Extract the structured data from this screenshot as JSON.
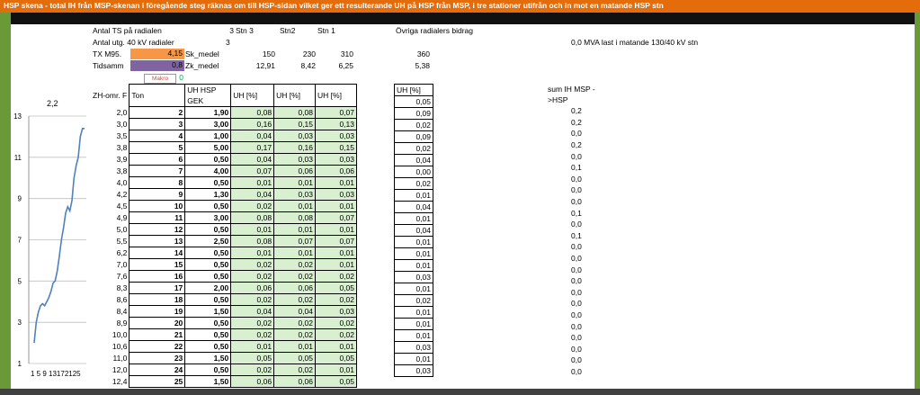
{
  "header": {
    "title": "HSP skena - total IH från MSP-skenan i föregående steg räknas om till HSP-sidan vilket ger ett resulterande UH på HSP från MSP, i tre stationer utifrån och in mot en matande HSP stn"
  },
  "info": {
    "antal_ts_label": "Antal TS på radialen",
    "antal_ts_value": "3",
    "stn3": "Stn 3",
    "stn2": "Stn2",
    "stn1": "Stn 1",
    "ovriga": "Övriga radialers bidrag",
    "antal_utg_label": "Antal utg. 40 kV radialer",
    "antal_utg_value": "3",
    "mva_text": "0,0  MVA last i matande 130/40 kV stn",
    "tx_label": "TX M95.",
    "tx_value": "4,15",
    "sk_label": "Sk_medel",
    "sk_stn3": "150",
    "sk_stn2": "230",
    "sk_stn1": "310",
    "sk_ovriga": "360",
    "tid_label": "Tidsamm",
    "tid_value": "0,8",
    "zk_label": "Zk_medel",
    "zk_stn3": "12,91",
    "zk_stn2": "8,42",
    "zk_stn1": "6,25",
    "zk_ovriga": "5,38",
    "makro": "Makro",
    "zero": "0"
  },
  "table": {
    "headers": [
      "ZH-omr. F",
      "Ton",
      "UH HSP GEK",
      "UH [%]",
      "UH [%]",
      "UH [%]",
      "UH [%]",
      "sum IH MSP ->HSP"
    ],
    "rows": [
      [
        "2,0",
        "2",
        "1,90",
        "0,08",
        "0,08",
        "0,07",
        "0,05",
        "0,2"
      ],
      [
        "3,0",
        "3",
        "3,00",
        "0,16",
        "0,15",
        "0,13",
        "0,09",
        "0,2"
      ],
      [
        "3,5",
        "4",
        "1,00",
        "0,04",
        "0,03",
        "0,03",
        "0,02",
        "0,0"
      ],
      [
        "3,8",
        "5",
        "5,00",
        "0,17",
        "0,16",
        "0,15",
        "0,09",
        "0,2"
      ],
      [
        "3,9",
        "6",
        "0,50",
        "0,04",
        "0,03",
        "0,03",
        "0,02",
        "0,0"
      ],
      [
        "3,8",
        "7",
        "4,00",
        "0,07",
        "0,06",
        "0,06",
        "0,04",
        "0,1"
      ],
      [
        "4,0",
        "8",
        "0,50",
        "0,01",
        "0,01",
        "0,01",
        "0,00",
        "0,0"
      ],
      [
        "4,2",
        "9",
        "1,30",
        "0,04",
        "0,03",
        "0,03",
        "0,02",
        "0,0"
      ],
      [
        "4,5",
        "10",
        "0,50",
        "0,02",
        "0,01",
        "0,01",
        "0,01",
        "0,0"
      ],
      [
        "4,9",
        "11",
        "3,00",
        "0,08",
        "0,08",
        "0,07",
        "0,04",
        "0,1"
      ],
      [
        "5,0",
        "12",
        "0,50",
        "0,01",
        "0,01",
        "0,01",
        "0,01",
        "0,0"
      ],
      [
        "5,5",
        "13",
        "2,50",
        "0,08",
        "0,07",
        "0,07",
        "0,04",
        "0,1"
      ],
      [
        "6,2",
        "14",
        "0,50",
        "0,01",
        "0,01",
        "0,01",
        "0,01",
        "0,0"
      ],
      [
        "7,0",
        "15",
        "0,50",
        "0,02",
        "0,02",
        "0,01",
        "0,01",
        "0,0"
      ],
      [
        "7,6",
        "16",
        "0,50",
        "0,02",
        "0,02",
        "0,02",
        "0,01",
        "0,0"
      ],
      [
        "8,3",
        "17",
        "2,00",
        "0,06",
        "0,06",
        "0,05",
        "0,03",
        "0,0"
      ],
      [
        "8,6",
        "18",
        "0,50",
        "0,02",
        "0,02",
        "0,02",
        "0,01",
        "0,0"
      ],
      [
        "8,4",
        "19",
        "1,50",
        "0,04",
        "0,04",
        "0,03",
        "0,02",
        "0,0"
      ],
      [
        "8,9",
        "20",
        "0,50",
        "0,02",
        "0,02",
        "0,02",
        "0,01",
        "0,0"
      ],
      [
        "10,0",
        "21",
        "0,50",
        "0,02",
        "0,02",
        "0,02",
        "0,01",
        "0,0"
      ],
      [
        "10,6",
        "22",
        "0,50",
        "0,01",
        "0,01",
        "0,01",
        "0,01",
        "0,0"
      ],
      [
        "11,0",
        "23",
        "1,50",
        "0,05",
        "0,05",
        "0,05",
        "0,03",
        "0,0"
      ],
      [
        "12,0",
        "24",
        "0,50",
        "0,02",
        "0,02",
        "0,01",
        "0,01",
        "0,0"
      ],
      [
        "12,4",
        "25",
        "1,50",
        "0,06",
        "0,06",
        "0,05",
        "0,03",
        "0,0"
      ]
    ]
  },
  "chart_data": {
    "type": "line",
    "title": "2,2",
    "x": [
      1,
      2,
      3,
      4,
      5,
      6,
      7,
      8,
      9,
      10,
      11,
      12,
      13,
      14,
      15,
      16,
      17,
      18,
      19,
      20,
      21,
      22,
      23,
      24,
      25
    ],
    "series": [
      {
        "values": [
          2.0,
          3.0,
          3.5,
          3.8,
          3.9,
          3.8,
          4.0,
          4.2,
          4.5,
          4.9,
          5.0,
          5.5,
          6.2,
          7.0,
          7.6,
          8.3,
          8.6,
          8.4,
          8.9,
          10.0,
          10.6,
          11.0,
          12.0,
          12.4,
          12.4
        ]
      }
    ],
    "ylim": [
      1,
      13
    ],
    "yticks": [
      "1",
      "3",
      "5",
      "7",
      "9",
      "11",
      "13"
    ],
    "xtick_text": "1 5 9 13172125",
    "grid": true,
    "line_color": "#4f81bd"
  },
  "colors": {
    "header": "#e46c0a",
    "border": "#6a9a37",
    "green_cell": "#d8f0d0",
    "orange_cell": "#f79646",
    "purple_cell": "#8064a2"
  }
}
